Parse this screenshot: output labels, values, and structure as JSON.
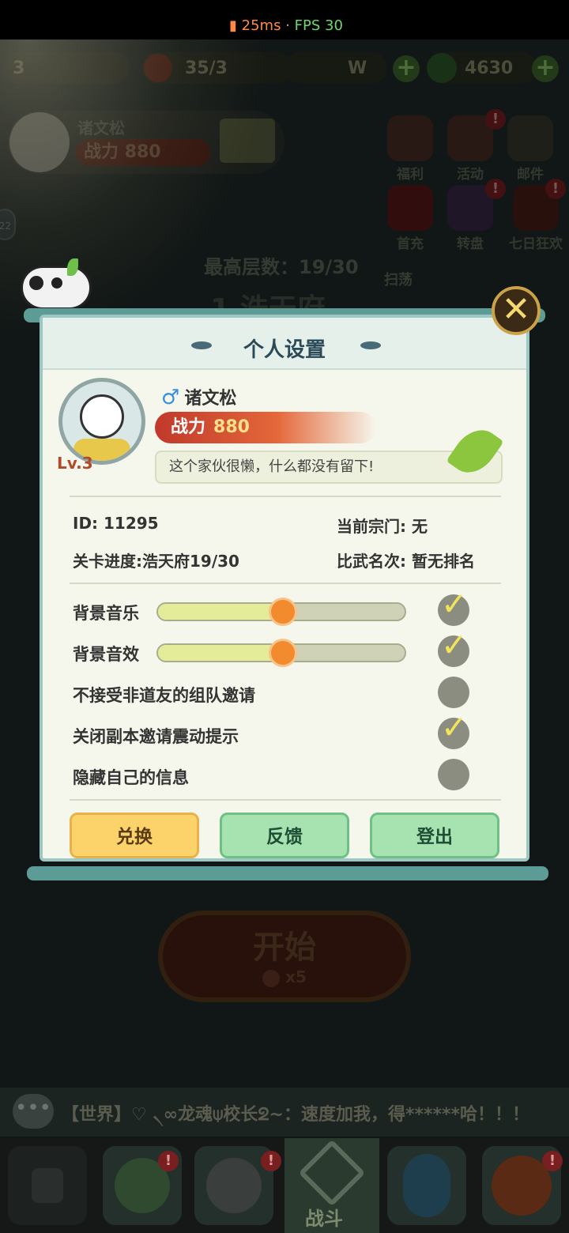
{
  "perf": {
    "ping": "25ms",
    "sep": "·",
    "fps": "FPS 30"
  },
  "hud": {
    "level": "3",
    "stamina": "35/3",
    "coins_fragment": "W",
    "jade": "4630",
    "player_name": "诸文松",
    "player_power_label": "战力",
    "player_power": "880",
    "side_badge": "22"
  },
  "menu_icons": [
    {
      "label": "福利"
    },
    {
      "label": "活动"
    },
    {
      "label": "邮件"
    },
    {
      "label": "首充"
    },
    {
      "label": "转盘"
    },
    {
      "label": "七日狂欢"
    }
  ],
  "tower": {
    "max_floor_label": "最高层数：",
    "max_floor": "19/30",
    "sweep": "扫荡",
    "stage_name": "1 浩天府"
  },
  "modal": {
    "title": "个人设置",
    "close": "✕",
    "level": "Lv.3",
    "gender_symbol": "♂",
    "name": "诸文松",
    "power_label": "战力",
    "power": "880",
    "signature": "这个家伙很懒，什么都没有留下!",
    "id_label": "ID:",
    "id": "11295",
    "sect_label": "当前宗门:",
    "sect": "无",
    "progress_label": "关卡进度:",
    "progress": "浩天府19/30",
    "rank_label": "比武名次:",
    "rank": "暂无排名",
    "settings": [
      {
        "label": "背景音乐",
        "slider": 0.5,
        "checked": true
      },
      {
        "label": "背景音效",
        "slider": 0.5,
        "checked": true
      },
      {
        "label": "不接受非道友的组队邀请",
        "checked": false
      },
      {
        "label": "关闭副本邀请震动提示",
        "checked": true
      },
      {
        "label": "隐藏自己的信息",
        "checked": false
      }
    ],
    "buttons": {
      "redeem": "兑换",
      "feedback": "反馈",
      "logout": "登出"
    }
  },
  "start": {
    "label": "开始",
    "cost": "x5"
  },
  "chat": {
    "icon": "•••",
    "text": "【世界】♡ ৲∞龙魂⍦校长ᘖ~：速度加我，得******哈！！！"
  },
  "tabs": {
    "battle": "战斗"
  },
  "colors": {
    "accent_orange": "#f28a2e",
    "power_red": "#c0392b",
    "check_yellow": "#f2e45a",
    "frame_teal": "#9cc7c2"
  }
}
